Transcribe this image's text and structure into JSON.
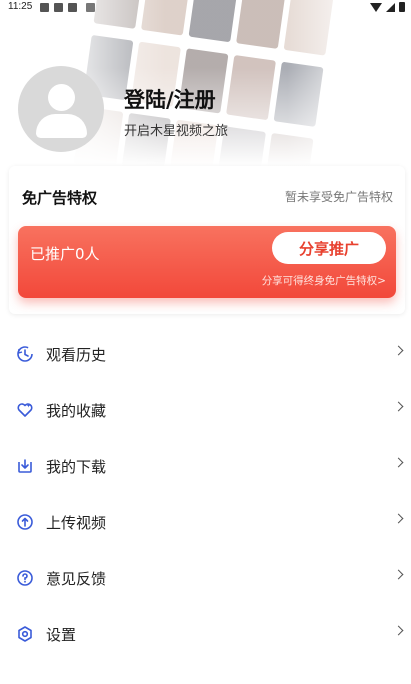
{
  "status_bar": {
    "time": "11:25"
  },
  "profile": {
    "login_label": "登陆/注册",
    "subtitle": "开启木星视频之旅"
  },
  "ad_card": {
    "title": "免广告特权",
    "status": "暂未享受免广告特权",
    "promo": {
      "count_text": "已推广0人",
      "share_button": "分享推广",
      "hint": "分享可得终身免广告特权>"
    }
  },
  "menu": [
    {
      "label": "观看历史",
      "icon": "history-icon"
    },
    {
      "label": "我的收藏",
      "icon": "heart-icon"
    },
    {
      "label": "我的下载",
      "icon": "download-icon"
    },
    {
      "label": "上传视频",
      "icon": "upload-icon"
    },
    {
      "label": "意见反馈",
      "icon": "help-icon"
    },
    {
      "label": "设置",
      "icon": "settings-icon"
    }
  ],
  "colors": {
    "accent": "#f2483a",
    "icon_blue": "#3a5bd9"
  }
}
